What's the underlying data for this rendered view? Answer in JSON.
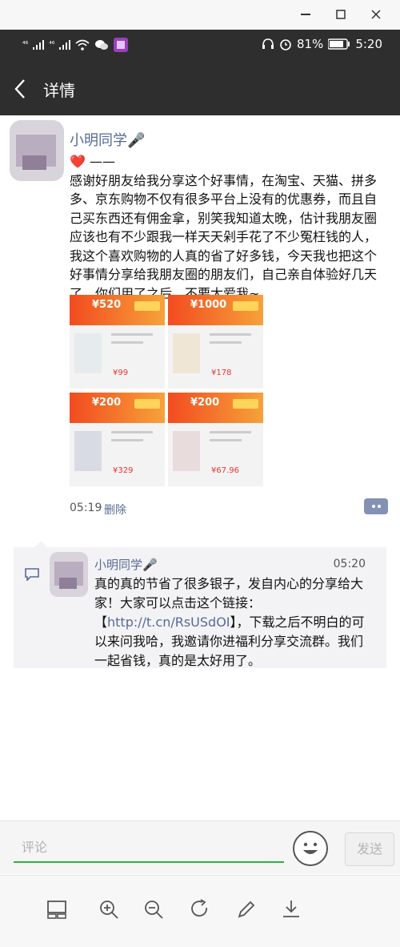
{
  "window": {
    "minimize_icon": "minimize-icon",
    "maximize_icon": "maximize-icon",
    "close_icon": "close-icon"
  },
  "status": {
    "signal1": "⁴⁶",
    "signal2": "⁴⁶",
    "battery_pct": "81%",
    "time": "5:20"
  },
  "nav": {
    "title": "详情"
  },
  "post": {
    "author": "小明同学🎤",
    "text": "❤️ ——\n感谢好朋友给我分享这个好事情，在淘宝、天猫、拼多多、京东购物不仅有很多平台上没有的优惠券，而且自己买东西还有佣金拿，别笑我知道太晚，估计我朋友圈应该也有不少跟我一样天天剁手花了不少冤枉钱的人，我这个喜欢购物的人真的省了好多钱，今天我也把这个好事情分享给我朋友圈的朋友们，自己亲自体验好几天了，你们用了之后，不要太爱我~",
    "images": [
      {
        "coupon": "¥520",
        "price": "¥99"
      },
      {
        "coupon": "¥1000",
        "price": "¥178"
      },
      {
        "coupon": "¥200",
        "price": "¥329"
      },
      {
        "coupon": "¥200",
        "price": "¥67.96"
      }
    ],
    "time": "05:19",
    "delete_label": "删除"
  },
  "comment": {
    "author": "小明同学🎤",
    "time": "05:20",
    "text_before": "真的真的节省了很多银子，发自内心的分享给大家！大家可以点击这个链接：【",
    "link": "http://t.cn/RsUSdOI",
    "text_after": "】，下载之后不明白的可以来问我哈，我邀请你进福利分享交流群。我们一起省钱，真的是太好用了。"
  },
  "input": {
    "placeholder": "评论",
    "send_label": "发送"
  },
  "colors": {
    "accent_green": "#28b444",
    "link_blue": "#576b95",
    "header_dark": "#2e2e2e"
  },
  "toolbar": [
    "layout-icon",
    "zoom-in-icon",
    "zoom-out-icon",
    "rotate-icon",
    "edit-icon",
    "download-icon"
  ]
}
